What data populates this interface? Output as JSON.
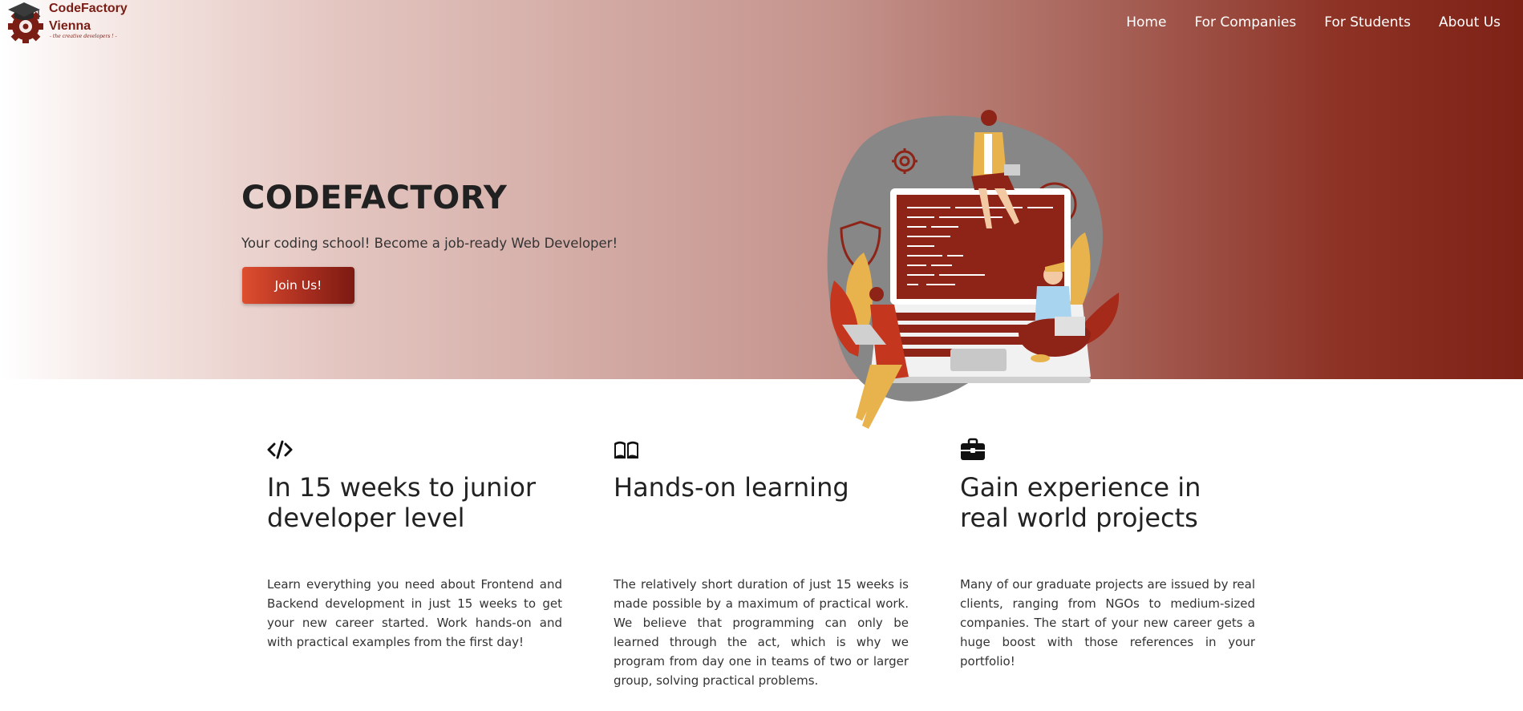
{
  "brand": {
    "name_line1": "CodeFactory",
    "name_line2": "Vienna",
    "tagline": "- the creative developers ! -"
  },
  "nav": {
    "items": [
      {
        "label": "Home"
      },
      {
        "label": "For Companies"
      },
      {
        "label": "For Students"
      },
      {
        "label": "About Us"
      }
    ]
  },
  "hero": {
    "title": "CODEFACTORY",
    "subtitle": "Your coding school! Become a job-ready Web Developer!",
    "cta_label": "Join Us!"
  },
  "features": [
    {
      "icon": "code-icon",
      "title": "In 15 weeks to junior developer level",
      "text": "Learn everything you need about Frontend and Backend development in just 15 weeks to get your new career started. Work hands-on and with practical examples from the first day!"
    },
    {
      "icon": "book-icon",
      "title": "Hands-on learning",
      "text": "The relatively short duration of just 15 weeks is made possible by a maximum of practical work. We believe that programming can only be learned through the act, which is why we program from day one in teams of two or larger group, solving practical problems."
    },
    {
      "icon": "briefcase-icon",
      "title": "Gain experience in real world projects",
      "text": "Many of our graduate projects are issued by real clients, ranging from NGOs to medium-sized companies. The start of your new career gets a huge boost with those references in your portfolio!"
    }
  ],
  "colors": {
    "brand": "#7a1d14",
    "accent": "#de4e2f",
    "text": "#222222"
  }
}
